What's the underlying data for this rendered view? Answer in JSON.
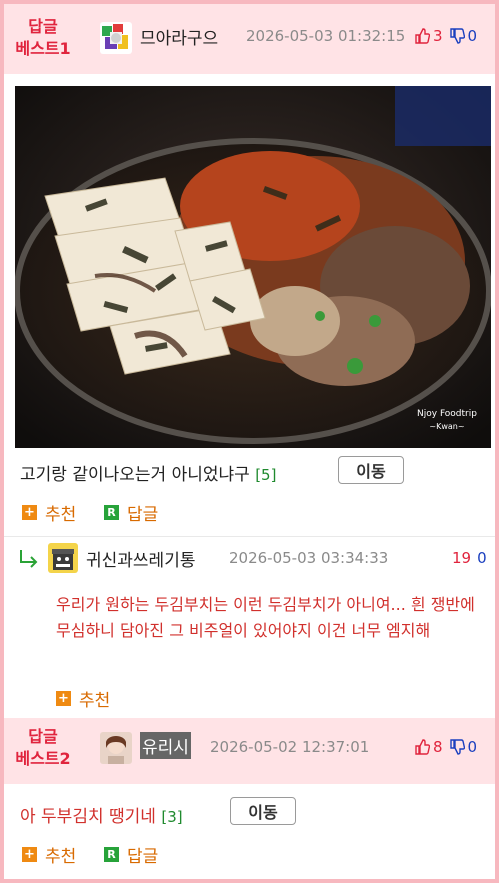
{
  "posts": [
    {
      "badge_line1": "답글",
      "badge_line2": "베스트1",
      "nick": "므아라구으",
      "date": "2026-05-03 01:32:15",
      "up": "3",
      "down": "0",
      "image_watermark": [
        "Njoy Foodtrip",
        "~Kwan~"
      ],
      "text": "고기랑 같이나오는거 아니었냐구",
      "comment_count": "[5]",
      "move_label": "이동",
      "recommend_label": "추천",
      "reply_label": "답글"
    },
    {
      "badge_line1": "답글",
      "badge_line2": "베스트2",
      "nick": "유리시",
      "date": "2026-05-02 12:37:01",
      "up": "8",
      "down": "0",
      "text": "아 두부김치 땡기네",
      "comment_count": "[3]",
      "move_label": "이동",
      "recommend_label": "추천",
      "reply_label": "답글"
    }
  ],
  "reply": {
    "nick": "귀신과쓰레기통",
    "date": "2026-05-03 03:34:33",
    "up": "19",
    "down": "0",
    "text": "우리가 원하는 두김부치는 이런 두김부치가 아니여... 흰 쟁반에 무심하니 담아진 그 비주얼이 있어야지 이건 너무 엠지해",
    "recommend_label": "추천"
  },
  "colors": {
    "accent_pink": "#f7b8bf",
    "header_bg": "#ffe3e6",
    "best_red": "#e0243d",
    "down_blue": "#1a3fbf",
    "count_green": "#1f8a2e",
    "action_orange": "#d86a00"
  }
}
